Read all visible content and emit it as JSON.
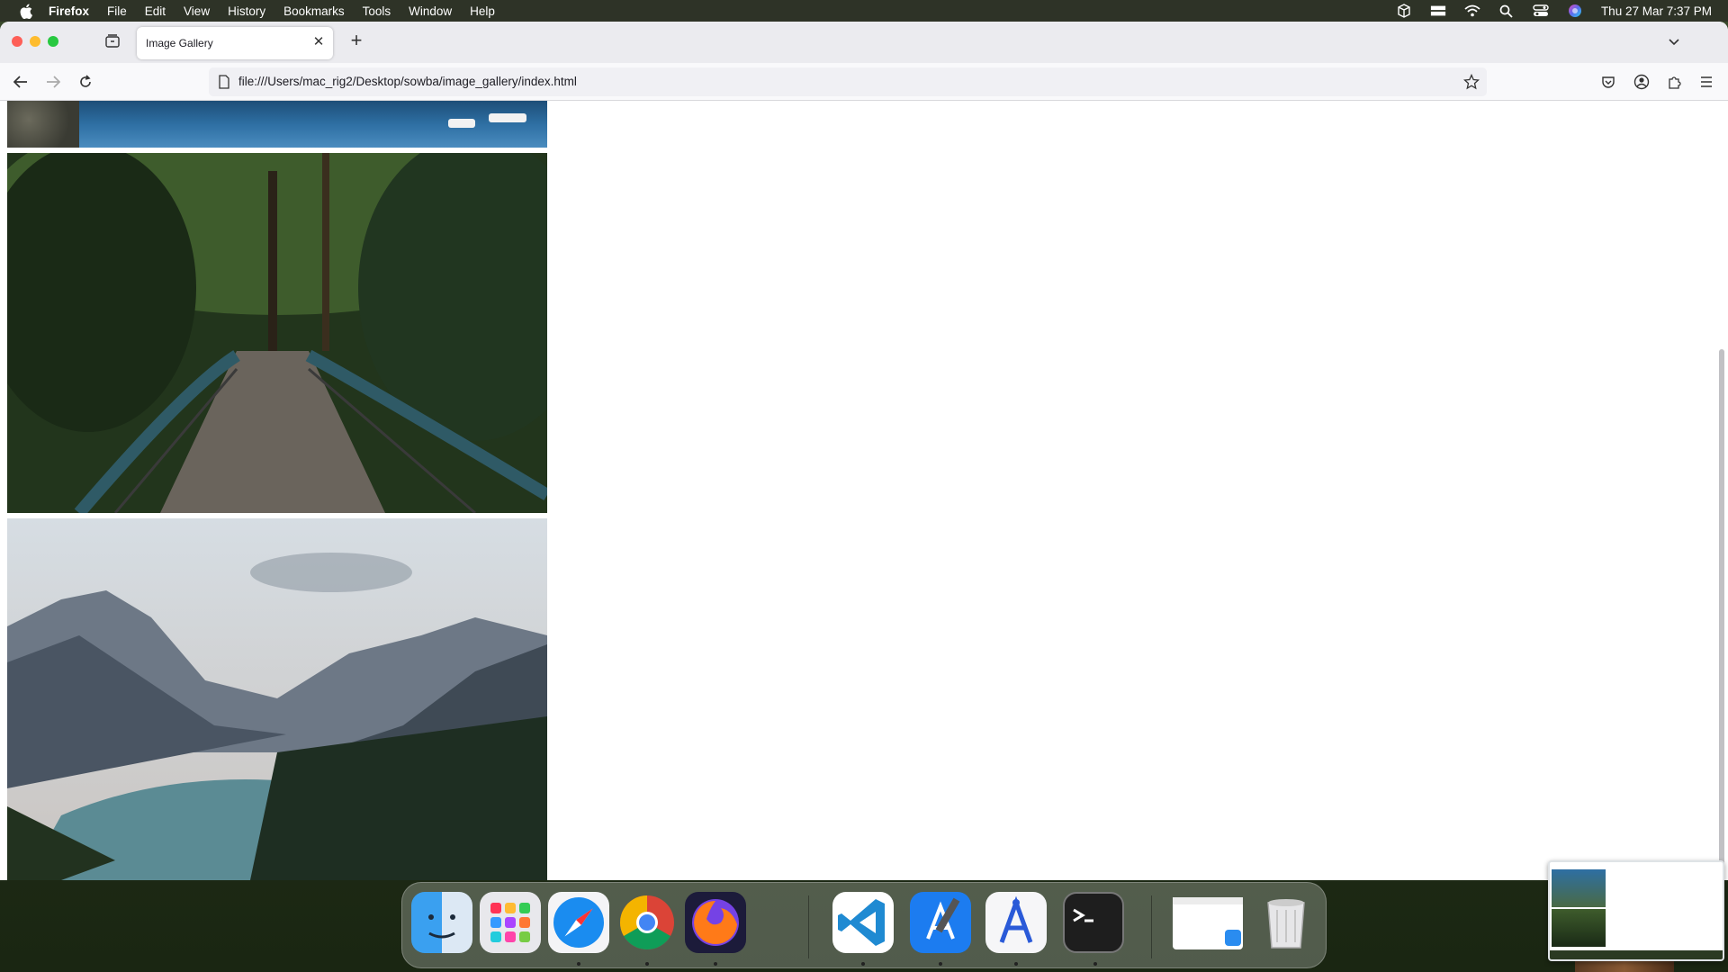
{
  "menubar": {
    "app_name": "Firefox",
    "items": [
      "File",
      "Edit",
      "View",
      "History",
      "Bookmarks",
      "Tools",
      "Window",
      "Help"
    ],
    "clock": "Thu 27 Mar  7:37 PM"
  },
  "browser": {
    "tab_title": "Image Gallery",
    "url": "file:///Users/mac_rig2/Desktop/sowba/image_gallery/index.html"
  },
  "gallery": {
    "images": [
      {
        "subject": "coastline-with-boats"
      },
      {
        "subject": "forest-bridge"
      },
      {
        "subject": "mountain-lake"
      }
    ]
  },
  "dock": {
    "apps": [
      "Finder",
      "Launchpad",
      "Safari",
      "Chrome",
      "Firefox",
      "VS Code",
      "Xcode",
      "Instruments",
      "Terminal",
      "Preview",
      "Trash"
    ]
  },
  "colors": {
    "menubar_bg": "#2e3327",
    "tabbar_bg": "#ebebef",
    "toolbar_bg": "#f9f9fb",
    "urlbar_bg": "#f0f0f4"
  }
}
